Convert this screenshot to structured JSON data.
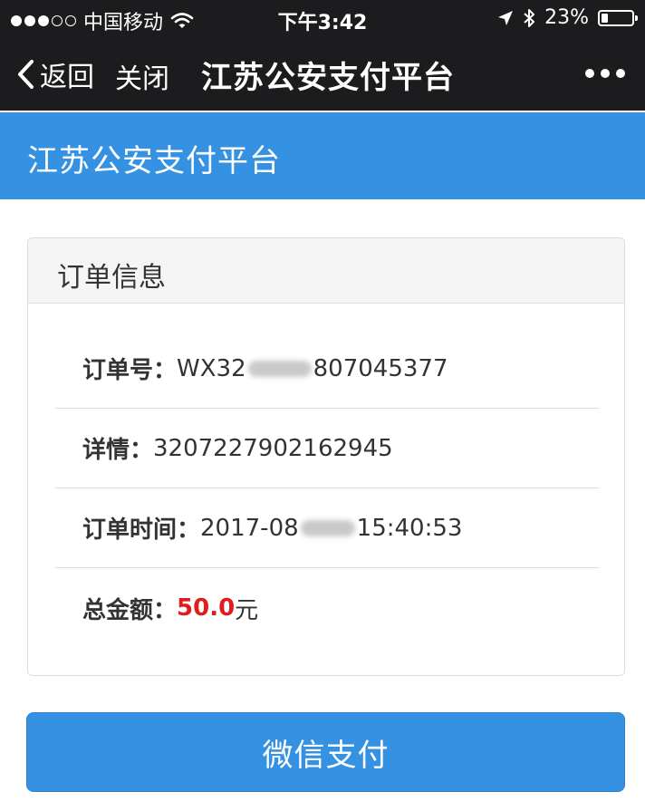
{
  "status_bar": {
    "carrier": "中国移动",
    "time": "下午3:42",
    "battery": "23%",
    "battery_level": 0.23
  },
  "nav": {
    "back_label": "返回",
    "close_label": "关闭",
    "title": "江苏公安支付平台"
  },
  "header": {
    "title": "江苏公安支付平台"
  },
  "order": {
    "card_title": "订单信息",
    "order_no_label": "订单号：",
    "order_no_prefix": "WX32",
    "order_no_suffix": "807045377",
    "detail_label": "详情：",
    "detail_value": "3207227902162945",
    "time_label": "订单时间：",
    "time_prefix": "2017-08",
    "time_suffix": "15:40:53",
    "amount_label": "总金额：",
    "amount_value": "50.0",
    "amount_unit": "元"
  },
  "pay_button": {
    "label": "微信支付"
  },
  "colors": {
    "brand_blue": "#3592e2",
    "amount_red": "#e21b1b",
    "bar_dark": "#1c1c1e"
  }
}
